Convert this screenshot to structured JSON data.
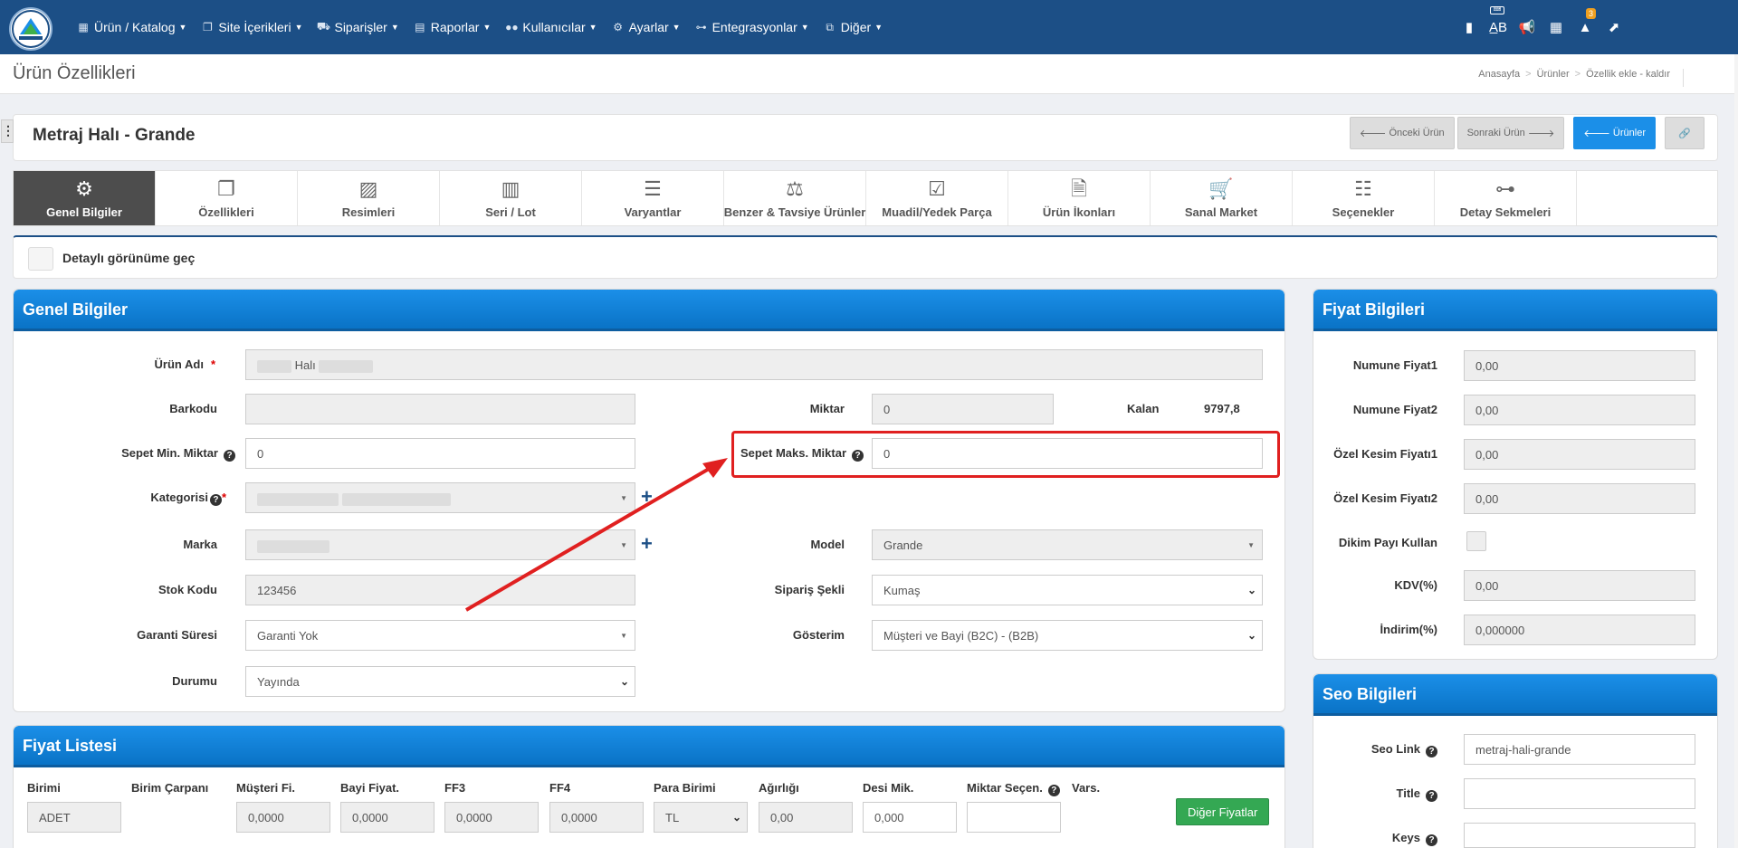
{
  "nav": {
    "items": [
      {
        "label": "Ürün / Katalog",
        "icon": "boxes-icon"
      },
      {
        "label": "Site İçerikleri",
        "icon": "copy-icon"
      },
      {
        "label": "Siparişler",
        "icon": "truck-icon"
      },
      {
        "label": "Raporlar",
        "icon": "print-icon"
      },
      {
        "label": "Kullanıcılar",
        "icon": "users-icon"
      },
      {
        "label": "Ayarlar",
        "icon": "cogs-icon"
      },
      {
        "label": "Entegrasyonlar",
        "icon": "sitemap-icon"
      },
      {
        "label": "Diğer",
        "icon": "clone-icon"
      }
    ],
    "alert_count": "3"
  },
  "page": {
    "title": "Ürün Özellikleri",
    "breadcrumb": [
      "Anasayfa",
      "Ürünler",
      "Özellik ekle - kaldır"
    ]
  },
  "product": {
    "title": "Metraj Halı - Grande",
    "prev_label": "Önceki Ürün",
    "next_label": "Sonraki Ürün",
    "products_label": "Ürünler"
  },
  "tabs": [
    {
      "label": "Genel Bilgiler",
      "icon": "cogs-icon"
    },
    {
      "label": "Özellikleri",
      "icon": "copy-icon"
    },
    {
      "label": "Resimleri",
      "icon": "images-icon"
    },
    {
      "label": "Seri / Lot",
      "icon": "barcode-icon"
    },
    {
      "label": "Varyantlar",
      "icon": "bars-icon"
    },
    {
      "label": "Benzer & Tavsiye Ürünler",
      "icon": "balance-scale-icon"
    },
    {
      "label": "Muadil/Yedek Parça",
      "icon": "check-square-icon"
    },
    {
      "label": "Ürün İkonları",
      "icon": "file-image-icon"
    },
    {
      "label": "Sanal Market",
      "icon": "cart-icon"
    },
    {
      "label": "Seçenekler",
      "icon": "list-icon"
    },
    {
      "label": "Detay Sekmeleri",
      "icon": "sitemap-icon"
    }
  ],
  "detail_toggle": {
    "label": "Detaylı görünüme geç"
  },
  "general": {
    "header": "Genel Bilgiler",
    "urun_adi_label": "Ürün Adı",
    "urun_adi_value": "Halı",
    "barkod_label": "Barkodu",
    "miktar_label": "Miktar",
    "miktar_value": "0",
    "kalan_label": "Kalan",
    "kalan_value": "9797,8",
    "sepet_min_label": "Sepet Min. Miktar",
    "sepet_min_value": "0",
    "sepet_maks_label": "Sepet Maks. Miktar",
    "sepet_maks_value": "0",
    "kategori_label": "Kategorisi",
    "marka_label": "Marka",
    "model_label": "Model",
    "model_value": "Grande",
    "stok_label": "Stok Kodu",
    "stok_value": "123456",
    "siparis_label": "Sipariş Şekli",
    "siparis_value": "Kumaş",
    "garanti_label": "Garanti Süresi",
    "garanti_value": "Garanti Yok",
    "gosterim_label": "Gösterim",
    "gosterim_value": "Müşteri ve Bayi (B2C) - (B2B)",
    "durum_label": "Durumu",
    "durum_value": "Yayında"
  },
  "price_list": {
    "header": "Fiyat Listesi",
    "columns": [
      "Birimi",
      "Birim Çarpanı",
      "Müşteri Fi.",
      "Bayi Fiyat.",
      "FF3",
      "FF4",
      "Para Birimi",
      "Ağırlığı",
      "Desi Mik.",
      "Miktar Seçen.",
      "Vars."
    ],
    "values": {
      "birim": "ADET",
      "musteri": "0,0000",
      "bayi": "0,0000",
      "ff3": "0,0000",
      "ff4": "0,0000",
      "para": "TL",
      "agirlik": "0,00",
      "desi": "0,000"
    },
    "other_prices_label": "Diğer Fiyatlar"
  },
  "price_info": {
    "header": "Fiyat Bilgileri",
    "rows": [
      {
        "label": "Numune Fiyat1",
        "value": "0,00"
      },
      {
        "label": "Numune Fiyat2",
        "value": "0,00"
      },
      {
        "label": "Özel Kesim Fiyatı1",
        "value": "0,00"
      },
      {
        "label": "Özel Kesim Fiyatı2",
        "value": "0,00"
      },
      {
        "label": "Dikim Payı Kullan",
        "value": ""
      },
      {
        "label": "KDV(%)",
        "value": "0,00"
      },
      {
        "label": "İndirim(%)",
        "value": "0,000000"
      }
    ]
  },
  "seo": {
    "header": "Seo Bilgileri",
    "link_label": "Seo Link",
    "link_value": "metraj-hali-grande",
    "title_label": "Title",
    "keys_label": "Keys"
  },
  "colors": {
    "nav": "#1c4f86",
    "accent": "#1b8fe8",
    "highlight": "#e02020",
    "green": "#34a853"
  }
}
